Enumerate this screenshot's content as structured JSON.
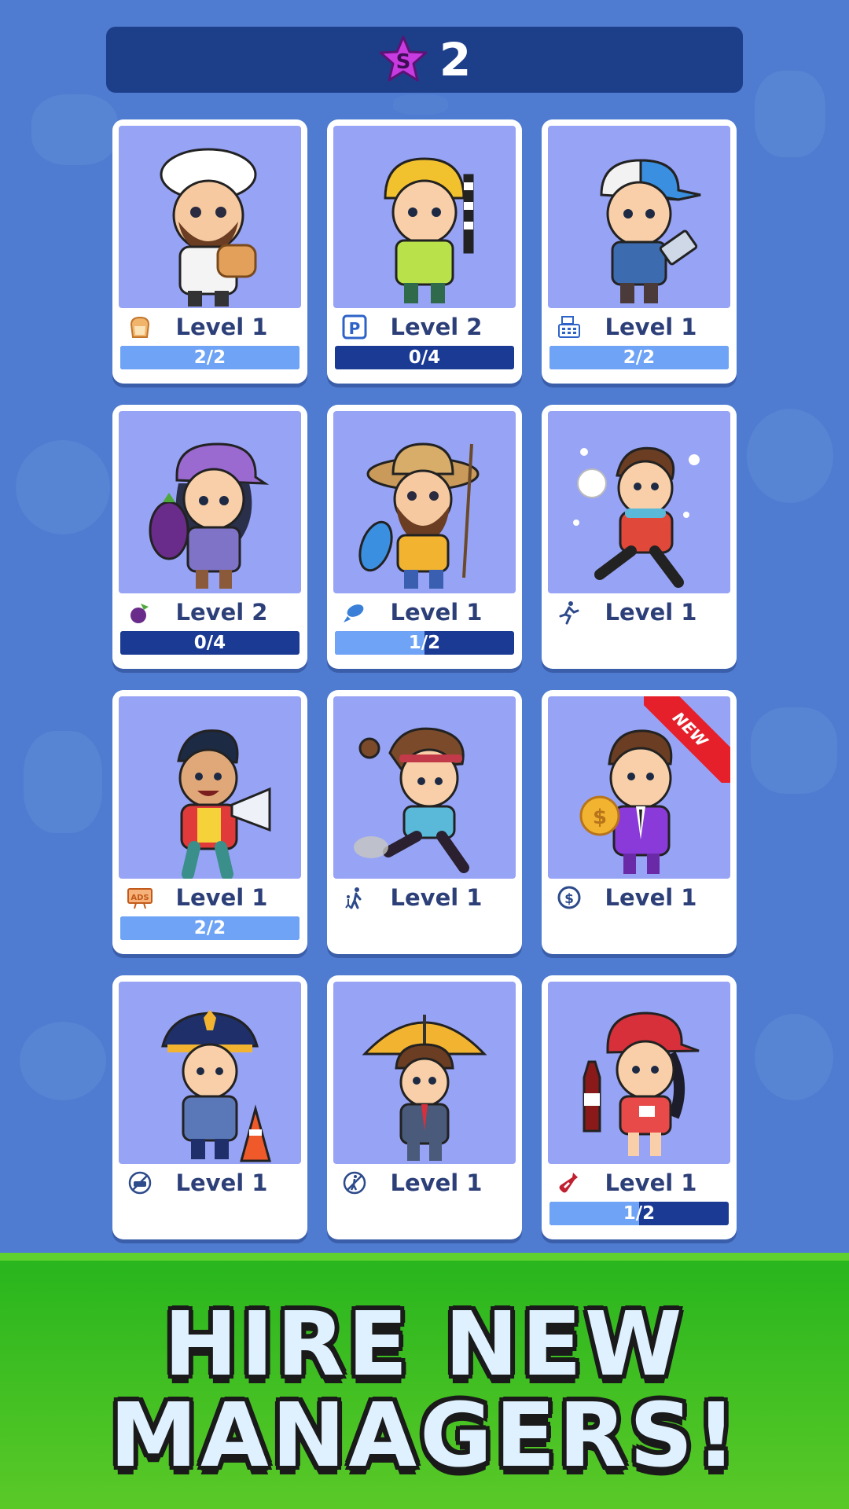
{
  "header": {
    "star_count": "2",
    "star_icon": "star-currency-icon",
    "star_letter": "S",
    "star_color": "#c83be0"
  },
  "managers": [
    {
      "name": "chef",
      "level": "Level 1",
      "icon": "bread-icon",
      "progress": "2/2",
      "progress_fraction": 1.0
    },
    {
      "name": "parking-attendant",
      "level": "Level 2",
      "icon": "parking-icon",
      "progress": "0/4",
      "progress_fraction": 0.0
    },
    {
      "name": "cashier",
      "level": "Level 1",
      "icon": "cash-register-icon",
      "progress": "2/2",
      "progress_fraction": 1.0
    },
    {
      "name": "farmer",
      "level": "Level 2",
      "icon": "eggplant-icon",
      "progress": "0/4",
      "progress_fraction": 0.0
    },
    {
      "name": "fisherman",
      "level": "Level 1",
      "icon": "fish-icon",
      "progress": "1/2",
      "progress_fraction": 0.5
    },
    {
      "name": "snowball-kid",
      "level": "Level 1",
      "icon": "running-person-icon",
      "progress": null,
      "progress_fraction": null
    },
    {
      "name": "promoter",
      "level": "Level 1",
      "icon": "ads-icon",
      "progress": "2/2",
      "progress_fraction": 1.0
    },
    {
      "name": "runner",
      "level": "Level 1",
      "icon": "walking-person-icon",
      "progress": null,
      "progress_fraction": null
    },
    {
      "name": "businessman",
      "level": "Level 1",
      "icon": "dollar-coin-icon",
      "progress": null,
      "progress_fraction": null,
      "badge": "NEW"
    },
    {
      "name": "police-officer",
      "level": "Level 1",
      "icon": "no-car-icon",
      "progress": null,
      "progress_fraction": null
    },
    {
      "name": "umbrella-man",
      "level": "Level 1",
      "icon": "no-walking-icon",
      "progress": null,
      "progress_fraction": null
    },
    {
      "name": "soda-vendor",
      "level": "Level 1",
      "icon": "soda-bottle-icon",
      "progress": "1/2",
      "progress_fraction": 0.5
    }
  ],
  "banner": {
    "line1": "HIRE NEW",
    "line2": "MANAGERS!"
  },
  "colors": {
    "background": "#4f7cd0",
    "topbar": "#1d3f8a",
    "portrait": "#97a3f5",
    "progress_empty": "#1a3a94",
    "progress_fill": "#6ea3f6",
    "banner": "#3cbd22",
    "new_badge": "#e5202a"
  }
}
